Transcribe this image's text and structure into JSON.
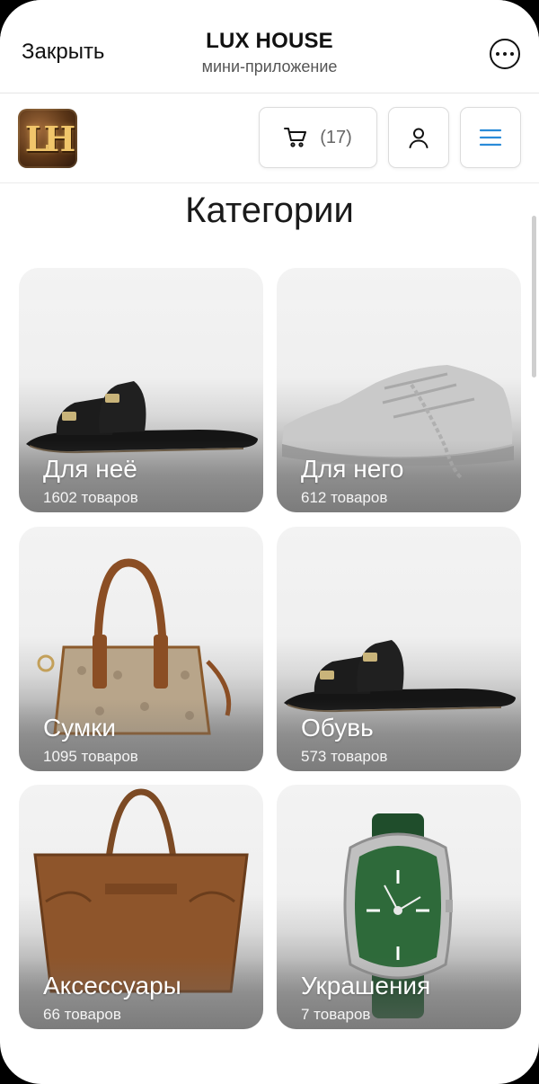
{
  "topbar": {
    "close_label": "Закрыть",
    "title": "LUX HOUSE",
    "subtitle": "мини-приложение",
    "more_icon": "more-dots-icon"
  },
  "header": {
    "logo_text": "LH",
    "cart_count": "(17)",
    "cart_icon": "cart-icon",
    "profile_icon": "user-icon",
    "menu_icon": "hamburger-menu-icon",
    "accent_color": "#2a8bd8"
  },
  "main": {
    "title": "Категории",
    "categories": [
      {
        "name": "Для неё",
        "count": "1602 товаров",
        "image": "sandal"
      },
      {
        "name": "Для него",
        "count": "612 товаров",
        "image": "sneaker"
      },
      {
        "name": "Сумки",
        "count": "1095 товаров",
        "image": "handbag"
      },
      {
        "name": "Обувь",
        "count": "573 товаров",
        "image": "sandal"
      },
      {
        "name": "Аксессуары",
        "count": "66 товаров",
        "image": "tote-bag"
      },
      {
        "name": "Украшения",
        "count": "7 товаров",
        "image": "watch"
      }
    ]
  }
}
